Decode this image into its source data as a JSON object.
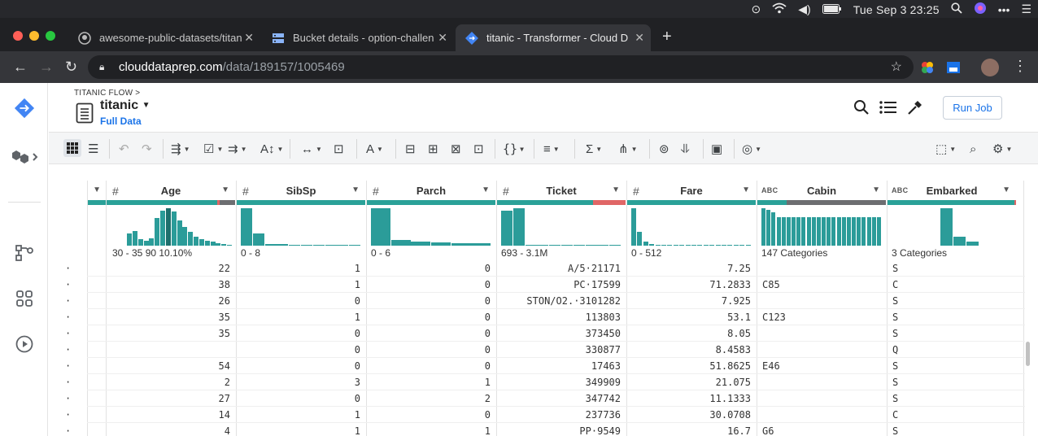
{
  "menubar": {
    "clock": "Tue Sep 3  23:25"
  },
  "tabs": [
    {
      "title": "awesome-public-datasets/titan",
      "icon": "github-icon"
    },
    {
      "title": "Bucket details - option-challen",
      "icon": "bucket-icon"
    },
    {
      "title": "titanic - Transformer - Cloud D",
      "icon": "dataprep-icon"
    }
  ],
  "address": {
    "host": "clouddataprep.com",
    "path": "/data/189157/1005469"
  },
  "header": {
    "breadcrumb": "TITANIC FLOW",
    "breadcrumb_sep": ">",
    "dataset": "titanic",
    "sample": "Full Data",
    "run_job": "Run Job"
  },
  "columns": [
    {
      "name": "Age",
      "type": "#",
      "hist_label": "30 - 35  90  10.10%",
      "values": [
        20,
        24,
        10,
        8,
        12,
        44,
        56,
        60,
        55,
        40,
        30,
        22,
        14,
        11,
        8,
        6,
        4,
        2,
        1
      ]
    },
    {
      "name": "SibSp",
      "type": "#",
      "hist_label": "0 - 8",
      "values": [
        85,
        28,
        3,
        3,
        2,
        1,
        1,
        1,
        1,
        1
      ]
    },
    {
      "name": "Parch",
      "type": "#",
      "hist_label": "0 - 6",
      "values": [
        85,
        13,
        9,
        7,
        6,
        5
      ]
    },
    {
      "name": "Ticket",
      "type": "#",
      "hist_label": "693 - 3.1M",
      "values": [
        75,
        80,
        1,
        1,
        1,
        1,
        1,
        1,
        1,
        1
      ]
    },
    {
      "name": "Fare",
      "type": "#",
      "hist_label": "0 - 512",
      "values": [
        95,
        35,
        10,
        5,
        3,
        2,
        2,
        1,
        1,
        1,
        1,
        1,
        1,
        1,
        1,
        1,
        1,
        1,
        1,
        1
      ]
    },
    {
      "name": "Cabin",
      "type": "ABC",
      "hist_label": "147 Categories",
      "values": [
        100,
        95,
        90,
        75,
        75,
        75,
        75,
        75,
        75,
        75,
        75,
        75,
        75,
        75,
        75,
        75,
        75,
        75,
        75,
        75,
        75,
        75,
        75,
        75
      ]
    },
    {
      "name": "Embarked",
      "type": "ABC",
      "hist_label": "3 Categories",
      "values": [
        100,
        24,
        11
      ]
    }
  ],
  "rows": [
    {
      "age": "22",
      "sibsp": "1",
      "parch": "0",
      "ticket": "A/5·21171",
      "fare": "7.25",
      "cabin": "",
      "emb": "S"
    },
    {
      "age": "38",
      "sibsp": "1",
      "parch": "0",
      "ticket": "PC·17599",
      "fare": "71.2833",
      "cabin": "C85",
      "emb": "C"
    },
    {
      "age": "26",
      "sibsp": "0",
      "parch": "0",
      "ticket": "STON/O2.·3101282",
      "fare": "7.925",
      "cabin": "",
      "emb": "S"
    },
    {
      "age": "35",
      "sibsp": "1",
      "parch": "0",
      "ticket": "113803",
      "fare": "53.1",
      "cabin": "C123",
      "emb": "S"
    },
    {
      "age": "35",
      "sibsp": "0",
      "parch": "0",
      "ticket": "373450",
      "fare": "8.05",
      "cabin": "",
      "emb": "S"
    },
    {
      "age": "",
      "sibsp": "0",
      "parch": "0",
      "ticket": "330877",
      "fare": "8.4583",
      "cabin": "",
      "emb": "Q"
    },
    {
      "age": "54",
      "sibsp": "0",
      "parch": "0",
      "ticket": "17463",
      "fare": "51.8625",
      "cabin": "E46",
      "emb": "S"
    },
    {
      "age": "2",
      "sibsp": "3",
      "parch": "1",
      "ticket": "349909",
      "fare": "21.075",
      "cabin": "",
      "emb": "S"
    },
    {
      "age": "27",
      "sibsp": "0",
      "parch": "2",
      "ticket": "347742",
      "fare": "11.1333",
      "cabin": "",
      "emb": "S"
    },
    {
      "age": "14",
      "sibsp": "1",
      "parch": "0",
      "ticket": "237736",
      "fare": "30.0708",
      "cabin": "",
      "emb": "C"
    },
    {
      "age": "4",
      "sibsp": "1",
      "parch": "1",
      "ticket": "PP·9549",
      "fare": "16.7",
      "cabin": "G6",
      "emb": "S"
    }
  ],
  "row_marker": "·",
  "colors": {
    "accent": "#1a73e8",
    "bar": "#2b9c99",
    "missing": "#e06666",
    "mismatch": "#6d6e71"
  }
}
